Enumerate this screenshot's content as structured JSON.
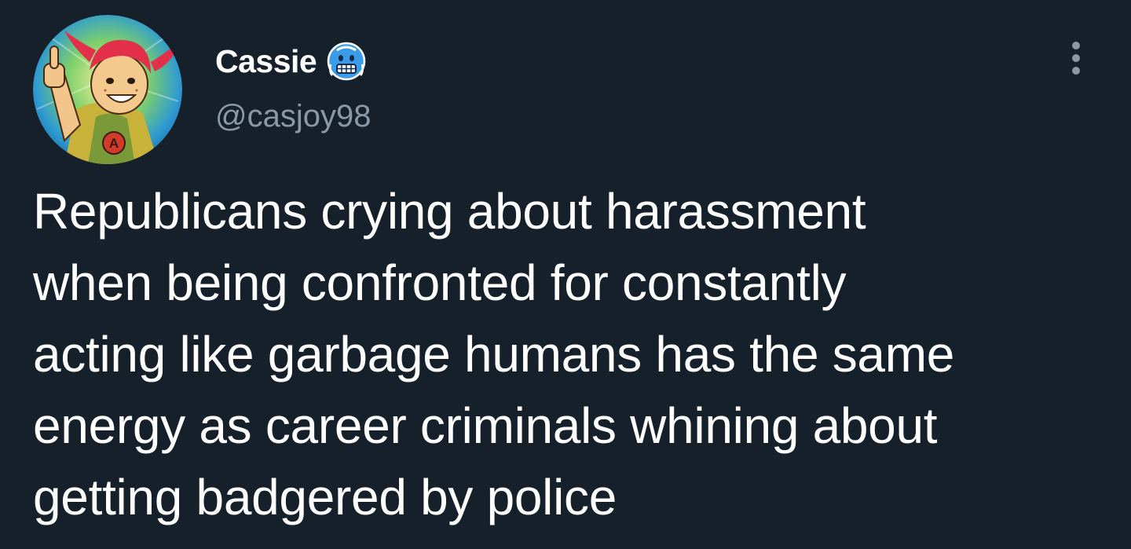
{
  "author": {
    "display_name": "Cassie",
    "handle": "@casjoy98",
    "name_emoji_icon": "cold-face-emoji-icon",
    "avatar_icon": "cartoon-girl-avatar-icon"
  },
  "menu": {
    "icon": "more-options-icon"
  },
  "tweet": {
    "text": "Republicans crying about harassment\nwhen being confronted for constantly\nacting like garbage humans has the same\nenergy as career criminals whining about\ngetting badgered by police"
  },
  "colors": {
    "background": "#15202b",
    "primary_text": "#ffffff",
    "secondary_text": "#8b98a5",
    "emoji_blue": "#3a9be8"
  }
}
